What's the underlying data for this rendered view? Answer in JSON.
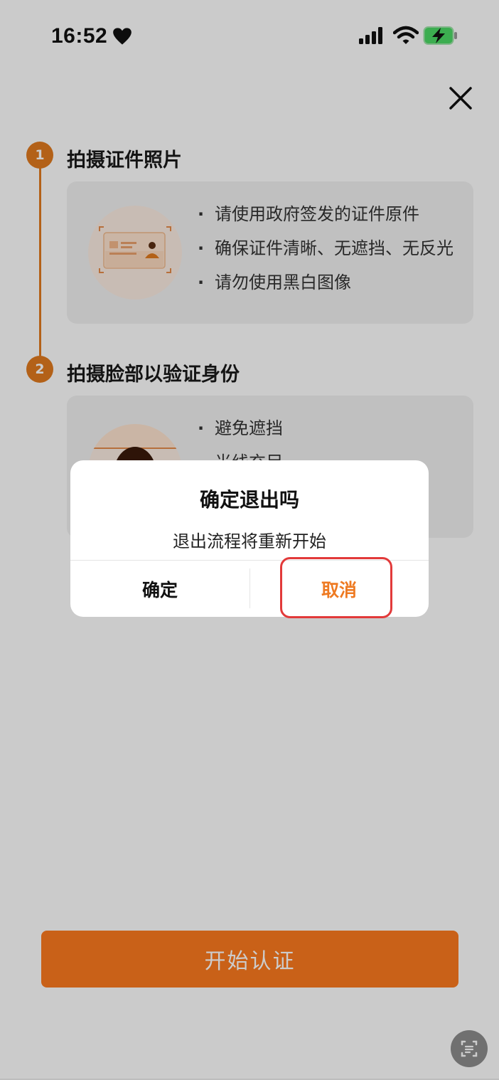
{
  "status": {
    "time": "16:52"
  },
  "steps": [
    {
      "number": "1",
      "title": "拍摄证件照片",
      "tips": [
        "请使用政府签发的证件原件",
        "确保证件清晰、无遮挡、无反光",
        "请勿使用黑白图像"
      ]
    },
    {
      "number": "2",
      "title": "拍摄脸部以验证身份",
      "tips": [
        "避免遮挡",
        "光线充足"
      ]
    }
  ],
  "start_button": "开始认证",
  "dialog": {
    "title": "确定退出吗",
    "message": "退出流程将重新开始",
    "confirm": "确定",
    "cancel": "取消"
  },
  "colors": {
    "accent": "#E07A1F",
    "button": "#FC7A1E",
    "cancel_text": "#EE7A22",
    "highlight": "#E23A3A"
  }
}
